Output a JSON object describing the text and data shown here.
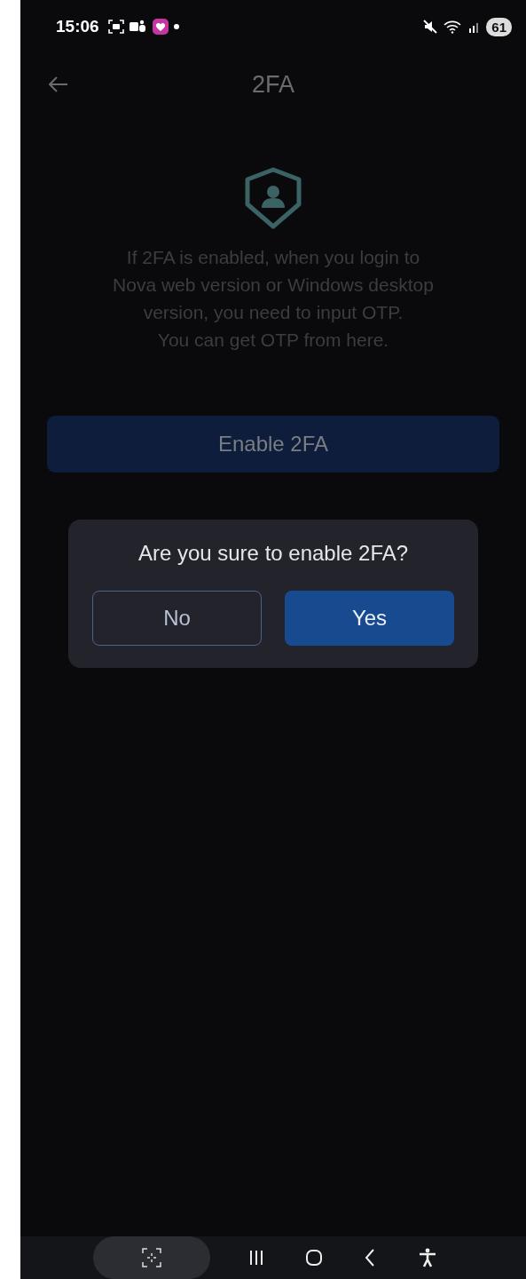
{
  "status_bar": {
    "time": "15:06",
    "battery": "61"
  },
  "app_bar": {
    "title": "2FA"
  },
  "description": [
    "If 2FA is enabled, when you login to",
    "Nova web version or Windows desktop",
    "version, you need to input OTP.",
    "You can get OTP from here."
  ],
  "enable_button": {
    "label": "Enable 2FA"
  },
  "dialog": {
    "message": "Are you sure to enable 2FA?",
    "buttons": [
      {
        "label": "No",
        "kind": "outline"
      },
      {
        "label": "Yes",
        "kind": "primary"
      }
    ]
  }
}
